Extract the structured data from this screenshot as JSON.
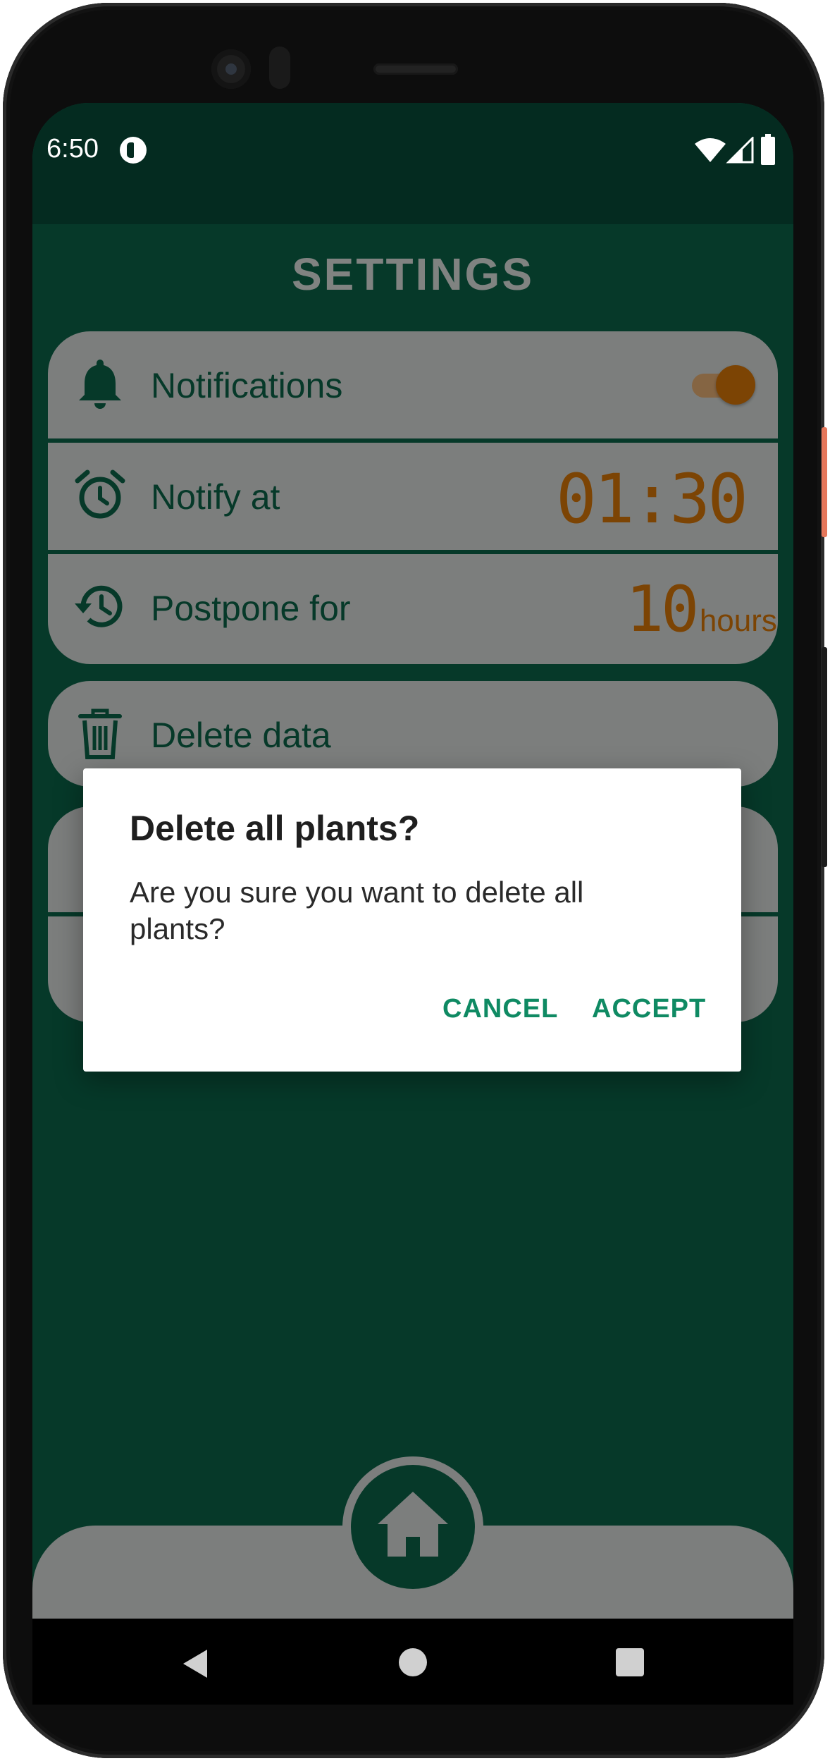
{
  "status_bar": {
    "time": "6:50"
  },
  "page": {
    "title": "SETTINGS"
  },
  "settings": {
    "notifications": {
      "label": "Notifications",
      "enabled": true
    },
    "notify_at": {
      "label": "Notify at",
      "value": "01:30"
    },
    "postpone_for": {
      "label": "Postpone for",
      "value": "10",
      "unit": "hours"
    },
    "delete_data": {
      "label": "Delete data"
    }
  },
  "dialog": {
    "title": "Delete all plants?",
    "message": "Are you sure you want to delete all plants?",
    "cancel_label": "CANCEL",
    "accept_label": "ACCEPT"
  },
  "colors": {
    "background": "#0b5d43",
    "card": "#c8ccca",
    "accent": "#c96f07",
    "dialog_button": "#0f8a63"
  },
  "icons": {
    "notifications": "bell-icon",
    "notify_at": "alarm-clock-icon",
    "postpone_for": "history-icon",
    "delete_data": "trash-icon",
    "home": "home-icon"
  }
}
